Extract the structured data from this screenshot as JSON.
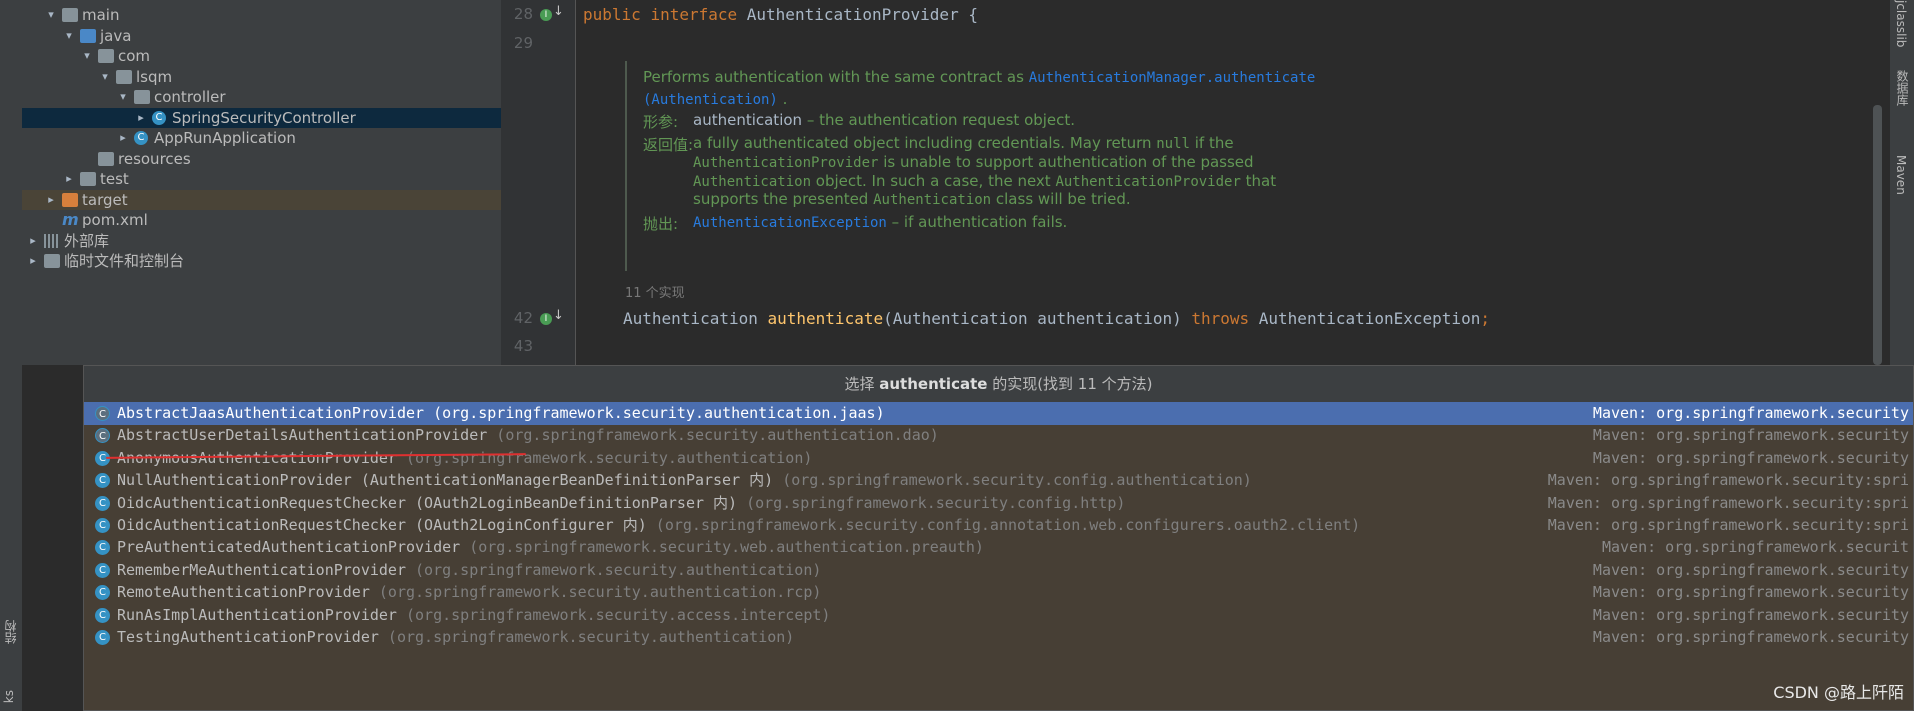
{
  "project_tree": [
    {
      "label": "main",
      "indent": 1,
      "arrow": "open",
      "icon": "folder"
    },
    {
      "label": "java",
      "indent": 2,
      "arrow": "open",
      "icon": "folder-blue"
    },
    {
      "label": "com",
      "indent": 3,
      "arrow": "open",
      "icon": "package"
    },
    {
      "label": "lsqm",
      "indent": 4,
      "arrow": "open",
      "icon": "package"
    },
    {
      "label": "controller",
      "indent": 5,
      "arrow": "open",
      "icon": "package"
    },
    {
      "label": "SpringSecurityController",
      "indent": 6,
      "arrow": "closed",
      "icon": "class",
      "selected": true
    },
    {
      "label": "AppRunApplication",
      "indent": 5,
      "arrow": "closed",
      "icon": "spring-class"
    },
    {
      "label": "resources",
      "indent": 3,
      "arrow": "none",
      "icon": "folder"
    },
    {
      "label": "test",
      "indent": 2,
      "arrow": "closed",
      "icon": "folder"
    },
    {
      "label": "target",
      "indent": 1,
      "arrow": "closed",
      "icon": "folder-orange",
      "highlight": true
    },
    {
      "label": "pom.xml",
      "indent": 1,
      "arrow": "none",
      "icon": "maven"
    },
    {
      "label": "外部库",
      "indent": 0,
      "arrow": "closed",
      "icon": "library"
    },
    {
      "label": "临时文件和控制台",
      "indent": 0,
      "arrow": "closed",
      "icon": "scratch"
    }
  ],
  "left_strip": {
    "structure": "结构",
    "bottom": "ks"
  },
  "right_strip": {
    "classlib": "jclasslib",
    "database": "数据库",
    "maven": "Maven"
  },
  "editor": {
    "line_28": "28",
    "line_29": "29",
    "line_42": "42",
    "line_43": "43",
    "code_28_kw1": "public",
    "code_28_kw2": "interface",
    "code_28_rest": " AuthenticationProvider {",
    "doc_line1": "Performs authentication with the same contract as ",
    "doc_link1": "AuthenticationManager.authenticate",
    "doc_link2": "(Authentication)",
    "doc_line2_end": ".",
    "param_tag": "形参:",
    "param_name": "authentication",
    "param_desc": " – the authentication request object.",
    "return_tag": "返回值:",
    "return_l1a": "a fully authenticated object including credentials. May return ",
    "return_l1b": "null",
    "return_l1c": " if the",
    "return_l2a": "AuthenticationProvider",
    "return_l2b": " is unable to support authentication of the passed",
    "return_l3a": "Authentication",
    "return_l3b": " object. In such a case, the next ",
    "return_l3c": "AuthenticationProvider",
    "return_l3d": " that",
    "return_l4a": "supports the presented ",
    "return_l4b": "Authentication",
    "return_l4c": " class will be tried.",
    "throws_tag": "抛出:",
    "throws_link": "AuthenticationException",
    "throws_desc": " – if authentication fails.",
    "impl_hint": "11 个实现",
    "code_42_a": "Authentication ",
    "code_42_fn": "authenticate",
    "code_42_b": "(Authentication authentication) ",
    "code_42_kw": "throws",
    "code_42_c": " AuthenticationException",
    "code_42_semi": ";"
  },
  "popup": {
    "title_prefix": "选择 ",
    "title_bold": "authenticate",
    "title_suffix": " 的实现(找到 11 个方法)",
    "items": [
      {
        "name": "AbstractJaasAuthenticationProvider",
        "pkg": " (org.springframework.security.authentication.jaas)",
        "module": "Maven: org.springframework.security",
        "selected": true,
        "abstract": true
      },
      {
        "name": "AbstractUserDetailsAuthenticationProvider",
        "pkg": " (org.springframework.security.authentication.dao)",
        "module": "Maven: org.springframework.security",
        "abstract": true
      },
      {
        "name": "AnonymousAuthenticationProvider",
        "pkg": " (org.springframework.security.authentication)",
        "module": "Maven: org.springframework.security"
      },
      {
        "name": "NullAuthenticationProvider (AuthenticationManagerBeanDefinitionParser 内)",
        "pkg": " (org.springframework.security.config.authentication)",
        "module": "Maven: org.springframework.security:spri"
      },
      {
        "name": "OidcAuthenticationRequestChecker (OAuth2LoginBeanDefinitionParser 内)",
        "pkg": " (org.springframework.security.config.http)",
        "module": "Maven: org.springframework.security:spri"
      },
      {
        "name": "OidcAuthenticationRequestChecker (OAuth2LoginConfigurer 内)",
        "pkg": " (org.springframework.security.config.annotation.web.configurers.oauth2.client)",
        "module": "Maven: org.springframework.security:spri"
      },
      {
        "name": "PreAuthenticatedAuthenticationProvider",
        "pkg": " (org.springframework.security.web.authentication.preauth)",
        "module": "Maven: org.springframework.securit"
      },
      {
        "name": "RememberMeAuthenticationProvider",
        "pkg": " (org.springframework.security.authentication)",
        "module": "Maven: org.springframework.security"
      },
      {
        "name": "RemoteAuthenticationProvider",
        "pkg": " (org.springframework.security.authentication.rcp)",
        "module": "Maven: org.springframework.security"
      },
      {
        "name": "RunAsImplAuthenticationProvider",
        "pkg": " (org.springframework.security.access.intercept)",
        "module": "Maven: org.springframework.security"
      },
      {
        "name": "TestingAuthenticationProvider",
        "pkg": " (org.springframework.security.authentication)",
        "module": "Maven: org.springframework.security"
      }
    ]
  },
  "watermark": "CSDN @路上阡陌"
}
